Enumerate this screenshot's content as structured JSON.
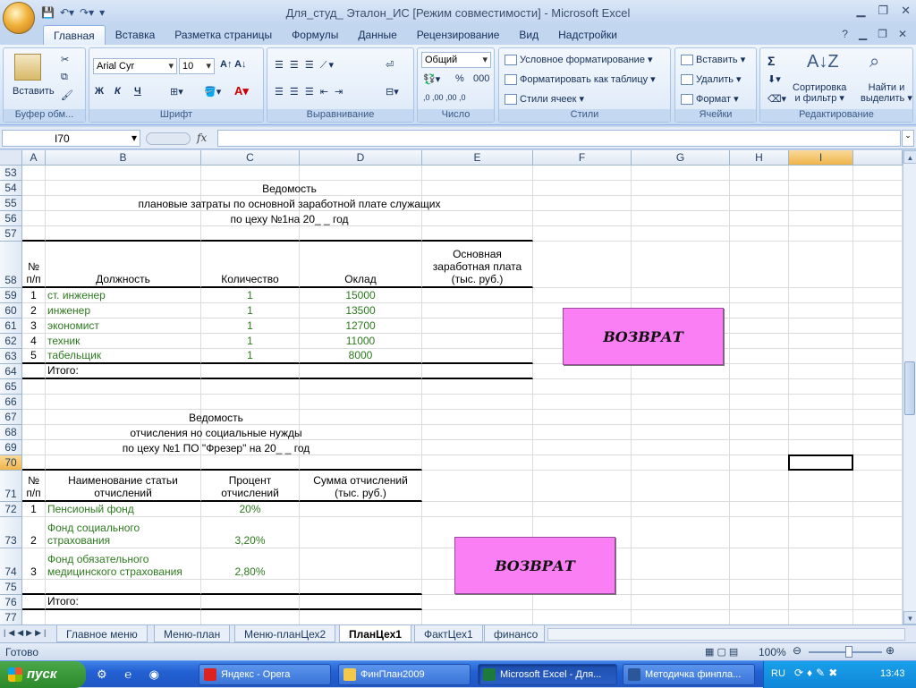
{
  "window": {
    "title": "Для_студ_ Эталон_ИС  [Режим совместимости] - Microsoft Excel"
  },
  "ribbon_tabs": [
    "Главная",
    "Вставка",
    "Разметка страницы",
    "Формулы",
    "Данные",
    "Рецензирование",
    "Вид",
    "Надстройки"
  ],
  "ribbon": {
    "clipboard": {
      "paste": "Вставить",
      "label": "Буфер обм..."
    },
    "font": {
      "name": "Arial Cyr",
      "size": "10",
      "bold": "Ж",
      "italic": "К",
      "underline": "Ч",
      "label": "Шрифт"
    },
    "alignment": {
      "label": "Выравнивание"
    },
    "number": {
      "format": "Общий",
      "percent": "%",
      "thousands": "000",
      "label": "Число"
    },
    "styles": {
      "conditional": "Условное форматирование",
      "format_table": "Форматировать как таблицу",
      "cell_styles": "Стили ячеек",
      "label": "Стили"
    },
    "cells": {
      "insert": "Вставить",
      "delete": "Удалить",
      "format": "Формат",
      "label": "Ячейки"
    },
    "editing": {
      "sum": "Σ",
      "sort1": "Сортировка",
      "sort2": "и фильтр",
      "find1": "Найти и",
      "find2": "выделить",
      "label": "Редактирование"
    }
  },
  "formula_bar": {
    "name_box": "I70",
    "fx": "fx",
    "formula": ""
  },
  "columns": [
    {
      "name": "A",
      "w": 26
    },
    {
      "name": "B",
      "w": 174
    },
    {
      "name": "C",
      "w": 110
    },
    {
      "name": "D",
      "w": 137
    },
    {
      "name": "E",
      "w": 124
    },
    {
      "name": "F",
      "w": 110
    },
    {
      "name": "G",
      "w": 110
    },
    {
      "name": "H",
      "w": 66
    },
    {
      "name": "I",
      "w": 72
    }
  ],
  "selected_column": "I",
  "selected_row": "70",
  "rows": [
    {
      "n": "53",
      "h": 17
    },
    {
      "n": "54",
      "h": 17,
      "span": {
        "text": "Ведомость"
      }
    },
    {
      "n": "55",
      "h": 17,
      "span": {
        "text": "плановые затраты по основной заработной плате служащих"
      }
    },
    {
      "n": "56",
      "h": 17,
      "span": {
        "text": "по цеху №1на 20_ _ год"
      }
    },
    {
      "n": "57",
      "h": 17,
      "bb": true
    },
    {
      "n": "58",
      "h": 52,
      "hdr": true,
      "cells": {
        "A": "№ п/п",
        "B": "Должность",
        "C": "Количество",
        "D": "Оклад",
        "E": "Основная заработная плата (тыс. руб.)"
      }
    },
    {
      "n": "59",
      "h": 17,
      "cells": {
        "A": "1",
        "B": "ст. инженер",
        "C": "1",
        "D": "15000"
      }
    },
    {
      "n": "60",
      "h": 17,
      "cells": {
        "A": "2",
        "B": "инженер",
        "C": "1",
        "D": "13500"
      }
    },
    {
      "n": "61",
      "h": 17,
      "cells": {
        "A": "3",
        "B": "экономист",
        "C": "1",
        "D": "12700"
      }
    },
    {
      "n": "62",
      "h": 17,
      "cells": {
        "A": "4",
        "B": "техник",
        "C": "1",
        "D": "11000"
      }
    },
    {
      "n": "63",
      "h": 17,
      "cells": {
        "A": "5",
        "B": "табельщик",
        "C": "1",
        "D": "8000"
      },
      "bb": true
    },
    {
      "n": "64",
      "h": 17,
      "cells": {
        "B": "Итого:"
      },
      "bb": true
    },
    {
      "n": "65",
      "h": 17
    },
    {
      "n": "66",
      "h": 17
    },
    {
      "n": "67",
      "h": 17,
      "span": {
        "text": "Ведомость"
      }
    },
    {
      "n": "68",
      "h": 17,
      "span": {
        "text": "отчисления но социальные нужды"
      }
    },
    {
      "n": "69",
      "h": 17,
      "span": {
        "text": "по цеху №1 ПО \"Фрезер\" на 20_ _ год"
      }
    },
    {
      "n": "70",
      "h": 17,
      "bb2": true
    },
    {
      "n": "71",
      "h": 35,
      "hdr2": true,
      "cells": {
        "A": "№ п/п",
        "B": "Наименование статьи отчислений",
        "C": "Процент отчислений",
        "D": "Сумма отчислений (тыс. руб.)"
      }
    },
    {
      "n": "72",
      "h": 17,
      "cells": {
        "A": "1",
        "B": "Пенсионый фонд",
        "C": "20%"
      }
    },
    {
      "n": "73",
      "h": 35,
      "cells": {
        "A": "2",
        "B": "Фонд социального страхования",
        "C": "3,20%"
      }
    },
    {
      "n": "74",
      "h": 35,
      "cells": {
        "A": "3",
        "B": "Фонд обязательного медицинского страхования",
        "C": "2,80%"
      }
    },
    {
      "n": "75",
      "h": 17,
      "bb2": true
    },
    {
      "n": "76",
      "h": 17,
      "cells": {
        "B": "Итого:"
      },
      "bb2": true
    },
    {
      "n": "77",
      "h": 17
    }
  ],
  "macro_buttons": [
    "ВОЗВРАТ",
    "ВОЗВРАТ"
  ],
  "sheet_tabs": [
    "Главное меню",
    "Меню-план",
    "Меню-планЦех2",
    "ПланЦех1",
    "ФактЦех1",
    "финансо"
  ],
  "active_sheet": "ПланЦех1",
  "status": {
    "ready": "Готово",
    "zoom": "100%"
  },
  "taskbar": {
    "start": "пуск",
    "items": [
      "Яндекс - Opera",
      "ФинПлан2009",
      "Microsoft Excel - Для...",
      "Методичка финпла..."
    ],
    "lang": "RU",
    "time": "13:43"
  }
}
